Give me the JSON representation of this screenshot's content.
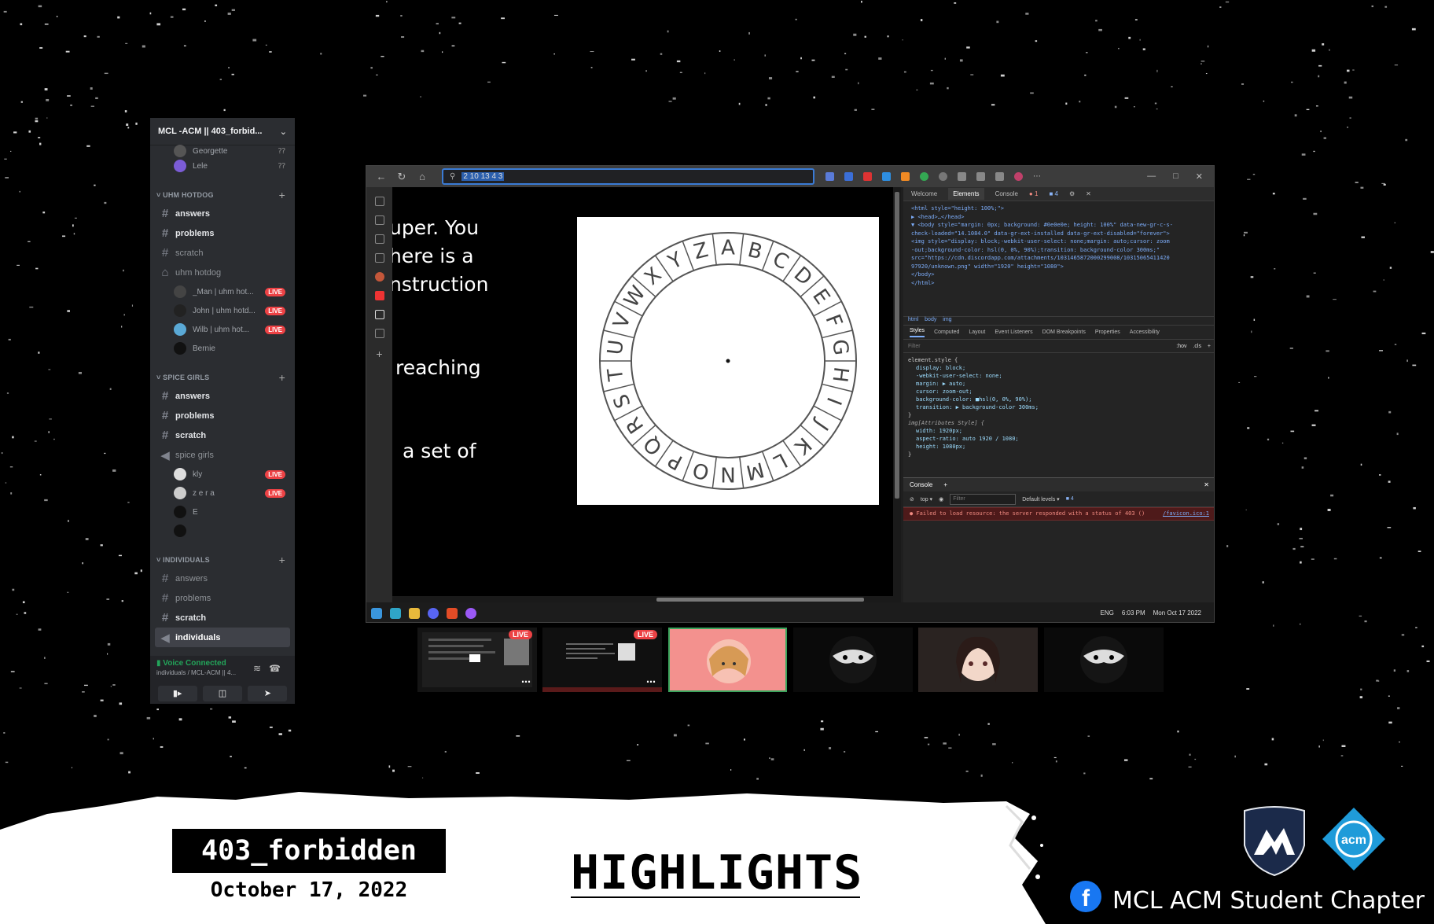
{
  "sidebar": {
    "server_name": "MCL -ACM || 403_forbid...",
    "top_users": [
      {
        "name": "Georgette",
        "color": "#555555"
      },
      {
        "name": "Lele",
        "color": "#7b5cd6"
      }
    ],
    "categories": [
      {
        "name": "UHM HOTDOG",
        "channels": [
          {
            "name": "answers",
            "type": "text",
            "bold": true
          },
          {
            "name": "problems",
            "type": "text",
            "bold": true
          },
          {
            "name": "scratch",
            "type": "text",
            "bold": false
          },
          {
            "name": "uhm hotdog",
            "type": "locked-voice",
            "bold": false
          }
        ],
        "users": [
          {
            "name": "_Man | uhm hot...",
            "live": true,
            "color": "#444444"
          },
          {
            "name": "John | uhm hotd...",
            "live": true,
            "color": "#222222"
          },
          {
            "name": "Wilb | uhm hot...",
            "live": true,
            "color": "#5aa9d6"
          },
          {
            "name": "Bernie",
            "live": false,
            "color": "#111111"
          }
        ]
      },
      {
        "name": "SPICE GIRLS",
        "channels": [
          {
            "name": "answers",
            "type": "text",
            "bold": true
          },
          {
            "name": "problems",
            "type": "text",
            "bold": true
          },
          {
            "name": "scratch",
            "type": "text",
            "bold": true
          },
          {
            "name": "spice girls",
            "type": "voice",
            "bold": false
          }
        ],
        "users": [
          {
            "name": "kly",
            "live": true,
            "color": "#dddddd"
          },
          {
            "name": "z e r a",
            "live": true,
            "color": "#cccccc"
          },
          {
            "name": "E",
            "live": false,
            "color": "#111111"
          },
          {
            "name": "",
            "live": false,
            "color": "#111111"
          }
        ]
      },
      {
        "name": "INDIVIDUALS",
        "channels": [
          {
            "name": "answers",
            "type": "text",
            "bold": false
          },
          {
            "name": "problems",
            "type": "text",
            "bold": false
          },
          {
            "name": "scratch",
            "type": "text",
            "bold": true
          },
          {
            "name": "individuals",
            "type": "voice",
            "bold": true,
            "selected": true
          }
        ],
        "users": []
      }
    ],
    "voice_status": "Voice Connected",
    "voice_location": "individuals / MCL-ACM || 4..."
  },
  "browser": {
    "url": "2 10 13 4 3",
    "page_lines": [
      "uper. You",
      "here is a",
      "nstruction",
      "reaching",
      "a set of"
    ],
    "cipher_letters": [
      "A",
      "B",
      "C",
      "D",
      "E",
      "F",
      "G",
      "H",
      "I",
      "J",
      "K",
      "L",
      "M",
      "N",
      "O",
      "P",
      "Q",
      "R",
      "S",
      "T",
      "U",
      "V",
      "W",
      "X",
      "Y",
      "Z"
    ],
    "devtools": {
      "tabs": [
        "Welcome",
        "Elements",
        "Console"
      ],
      "error_count": "1",
      "info_count": "4",
      "dom_lines": [
        "<html style=\"height: 100%;\">",
        "▶ <head>…</head>",
        "▼ <body style=\"margin: 0px; background: #0e0e0e; height: 100%\" data-new-gr-c-s-",
        "  check-loaded=\"14.1084.0\" data-gr-ext-installed data-gr-ext-disabled=\"forever\">",
        "    <img style=\"display: block;-webkit-user-select: none;margin: auto;cursor: zoom",
        "    -out;background-color: hsl(0, 0%, 90%);transition: background-color 300ms;\"",
        "    src=\"https://cdn.discordapp.com/attachments/1031465872000299008/10315065411420",
        "    97920/unknown.png\" width=\"1920\" height=\"1080\">",
        "  </body>",
        "</html>"
      ],
      "breadcrumbs": "html body img",
      "style_tabs": [
        "Styles",
        "Computed",
        "Layout",
        "Event Listeners",
        "DOM Breakpoints",
        "Properties",
        "Accessibility"
      ],
      "filter_placeholder": "Filter",
      "filter_tools": ":hov .cls +",
      "element_style_selector": "element.style {",
      "element_style_props": [
        "display: block;",
        "-webkit-user-select: none;",
        "margin: ▶ auto;",
        "cursor: zoom-out;",
        "background-color: ■hsl(0, 0%, 90%);",
        "transition: ▶ background-color 300ms;"
      ],
      "attr_style_selector": "img[Attributes Style] {",
      "attr_style_props": [
        "width: 1920px;",
        "aspect-ratio: auto 1920 / 1080;",
        "height: 1080px;"
      ],
      "console_tab": "Console",
      "console_context": "top",
      "console_filter": "Filter",
      "console_levels": "Default levels",
      "console_count": "4",
      "console_error": "Failed to load resource: the server responded with a status of 403 ()",
      "console_error_link": "/favicon.ico:1"
    },
    "tray_lang": "ENG",
    "tray_time": "6:03 PM",
    "tray_date": "Mon  Oct 17 2022"
  },
  "tiles": [
    {
      "type": "stream",
      "live": true,
      "live_label": "LIVE"
    },
    {
      "type": "stream",
      "live": true,
      "live_label": "LIVE"
    },
    {
      "type": "avatar-pink"
    },
    {
      "type": "avatar-mask"
    },
    {
      "type": "avatar-girl"
    },
    {
      "type": "avatar-mask"
    }
  ],
  "banner": {
    "title": "403_forbidden",
    "date": "October 17, 2022",
    "headline": "HIGHLIGHTS",
    "chapter": "MCL ACM Student Chapter",
    "facebook_glyph": "f",
    "acm_logo_text": "acm",
    "colors": {
      "facebook": "#1877f2",
      "shield": "#1b2a4a",
      "acm": "#1f9bd9"
    }
  },
  "labels": {
    "live": "LIVE"
  }
}
